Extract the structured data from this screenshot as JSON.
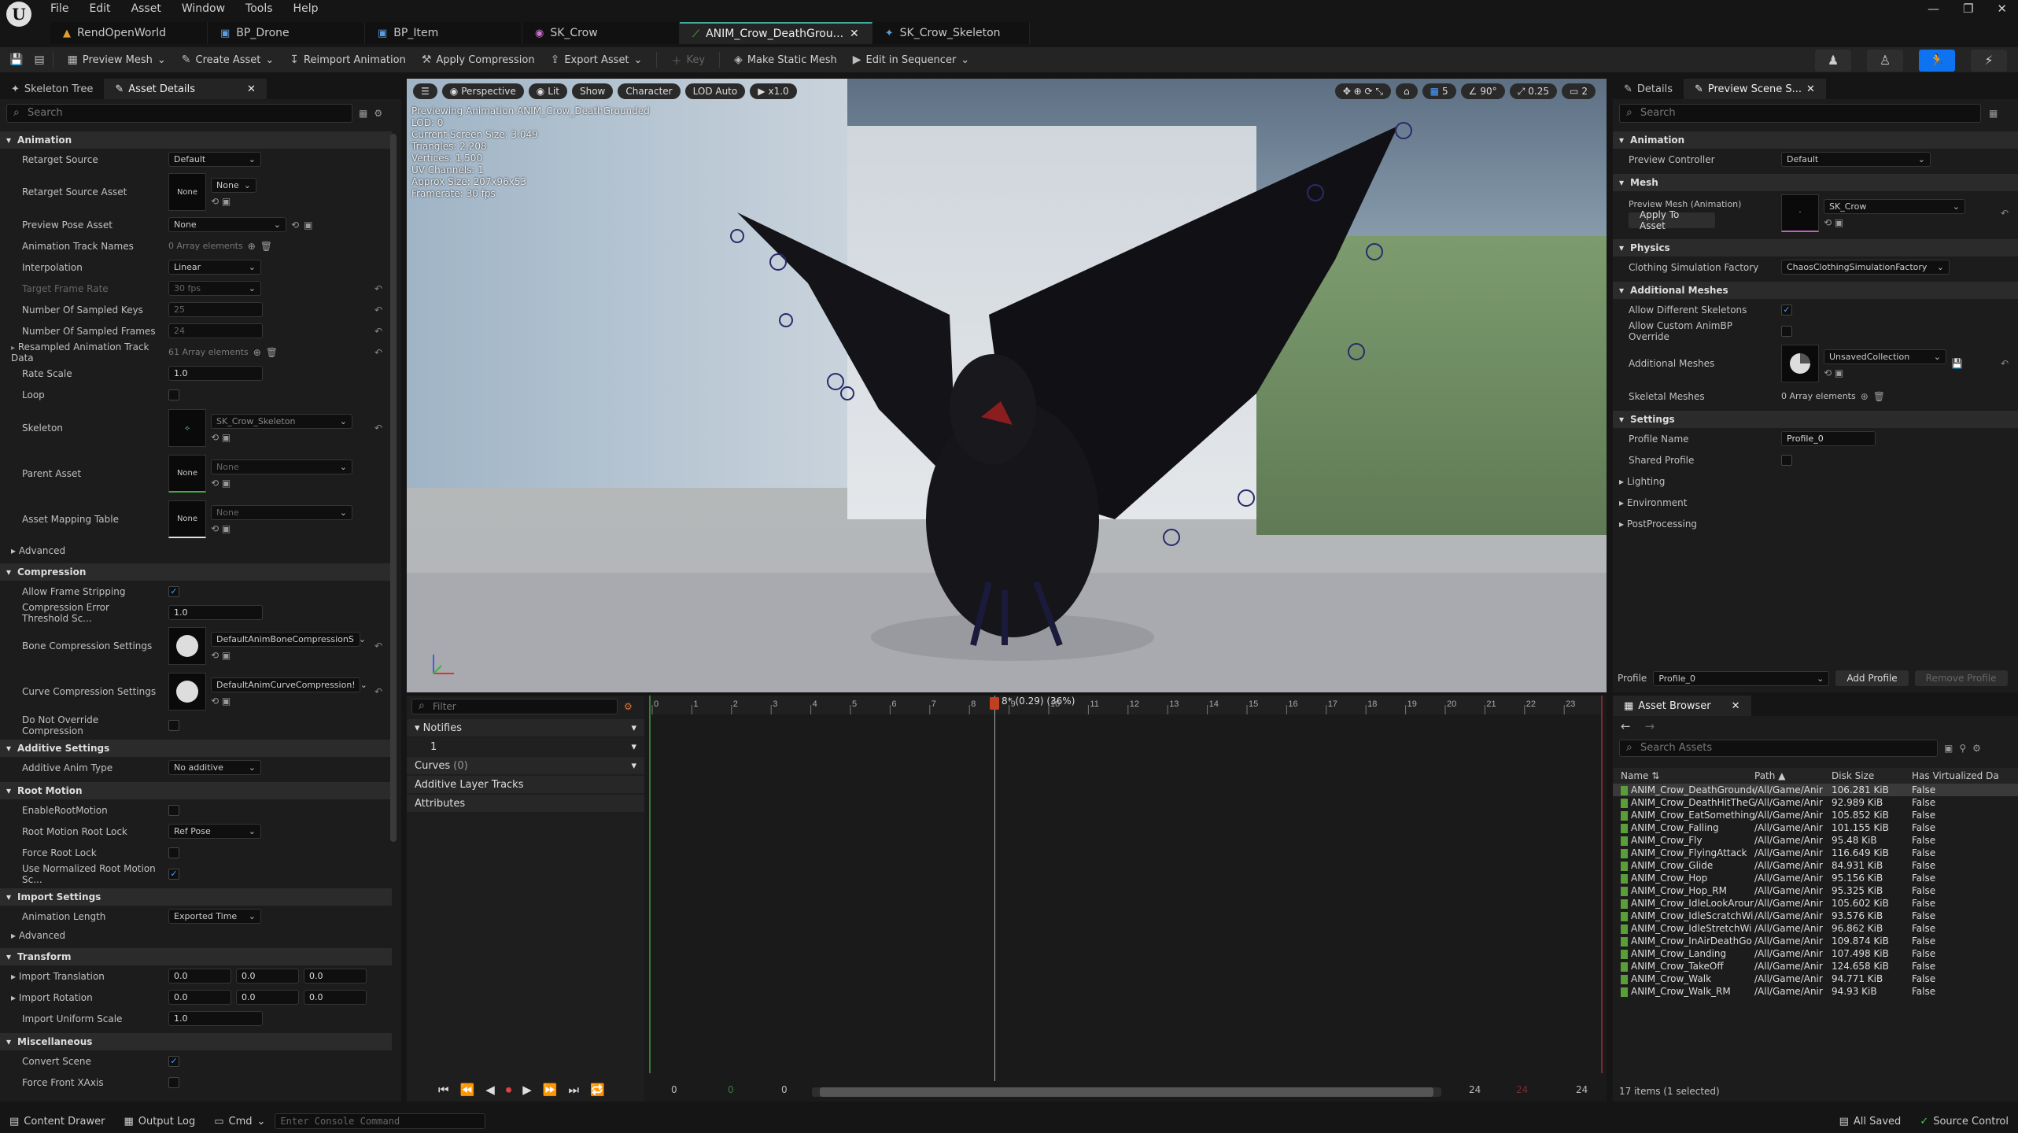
{
  "menu": [
    "File",
    "Edit",
    "Asset",
    "Window",
    "Tools",
    "Help"
  ],
  "doc_tabs": [
    {
      "label": "RendOpenWorld",
      "icon": "level-icon"
    },
    {
      "label": "BP_Drone",
      "icon": "blueprint-icon"
    },
    {
      "label": "BP_Item",
      "icon": "blueprint-icon"
    },
    {
      "label": "SK_Crow",
      "icon": "skeletal-mesh-icon"
    },
    {
      "label": "ANIM_Crow_DeathGrou...",
      "icon": "animation-icon",
      "active": true
    },
    {
      "label": "SK_Crow_Skeleton",
      "icon": "skeleton-icon"
    }
  ],
  "toolbar": {
    "preview_mesh": "Preview Mesh",
    "create_asset": "Create Asset",
    "reimport": "Reimport Animation",
    "apply_compression": "Apply Compression",
    "export_asset": "Export Asset",
    "key": "Key",
    "make_static_mesh": "Make Static Mesh",
    "edit_in_sequencer": "Edit in Sequencer"
  },
  "left_panel": {
    "tab_skeleton": "Skeleton Tree",
    "tab_details": "Asset Details",
    "search_placeholder": "Search",
    "cat_animation": "Animation",
    "cat_compression": "Compression",
    "cat_additive": "Additive Settings",
    "cat_root": "Root Motion",
    "cat_import": "Import Settings",
    "cat_transform": "Transform",
    "cat_misc": "Miscellaneous",
    "retarget_source": "Retarget Source",
    "retarget_source_val": "Default",
    "retarget_source_asset": "Retarget Source Asset",
    "none": "None",
    "preview_pose_asset": "Preview Pose Asset",
    "anim_track_names": "Animation Track Names",
    "array0": "0 Array elements",
    "interpolation": "Interpolation",
    "interpolation_val": "Linear",
    "target_frame_rate": "Target Frame Rate",
    "target_frame_rate_val": "30 fps",
    "num_sampled_keys": "Number Of Sampled Keys",
    "num_sampled_keys_val": "25",
    "num_sampled_frames": "Number Of Sampled Frames",
    "num_sampled_frames_val": "24",
    "resampled_track": "Resampled Animation Track Data",
    "array61": "61 Array elements",
    "rate_scale": "Rate Scale",
    "rate_scale_val": "1.0",
    "loop": "Loop",
    "skeleton": "Skeleton",
    "skeleton_val": "SK_Crow_Skeleton",
    "parent_asset": "Parent Asset",
    "asset_mapping": "Asset Mapping Table",
    "advanced": "Advanced",
    "allow_frame_stripping": "Allow Frame Stripping",
    "compression_error": "Compression Error Threshold Sc...",
    "compression_error_val": "1.0",
    "bone_compression": "Bone Compression Settings",
    "bone_compression_val": "DefaultAnimBoneCompressionS",
    "curve_compression": "Curve Compression Settings",
    "curve_compression_val": "DefaultAnimCurveCompression!",
    "do_not_override": "Do Not Override Compression",
    "additive_anim_type": "Additive Anim Type",
    "additive_anim_type_val": "No additive",
    "enable_root_motion": "EnableRootMotion",
    "root_motion_lock": "Root Motion Root Lock",
    "root_motion_lock_val": "Ref Pose",
    "force_root_lock": "Force Root Lock",
    "use_normalized": "Use Normalized Root Motion Sc...",
    "animation_length": "Animation Length",
    "animation_length_val": "Exported Time",
    "import_translation": "Import Translation",
    "import_rotation": "Import Rotation",
    "import_uniform_scale": "Import Uniform Scale",
    "zero": "0.0",
    "one": "1.0",
    "convert_scene": "Convert Scene",
    "force_front_xaxis": "Force Front XAxis"
  },
  "viewport": {
    "perspective": "Perspective",
    "lit": "Lit",
    "show": "Show",
    "character": "Character",
    "lod": "LOD Auto",
    "speed": "x1.0",
    "info": [
      "Previewing Animation ANIM_Crow_DeathGrounded",
      "LOD: 0",
      "Current Screen Size: 3.049",
      "Triangles: 2,208",
      "Vertices: 1,500",
      "UV Channels: 1",
      "Approx Size: 207x96x53",
      "Framerate: 30 fps"
    ],
    "grid": "5",
    "angle": "90°",
    "scale": "0.25",
    "cams": "2"
  },
  "timeline": {
    "filter_placeholder": "Filter",
    "notifies": "Notifies",
    "notify_track": "1",
    "curves": "Curves",
    "curves_count": "(0)",
    "additive_layer": "Additive Layer Tracks",
    "attributes": "Attributes",
    "playhead_label": "8* (0.29) (36%)",
    "ticks": [
      "0",
      "1",
      "2",
      "3",
      "4",
      "5",
      "6",
      "7",
      "8",
      "9",
      "10",
      "11",
      "12",
      "13",
      "14",
      "15",
      "16",
      "17",
      "18",
      "19",
      "20",
      "21",
      "22",
      "23"
    ],
    "range_start": "0",
    "range_start2": "0",
    "range_start3": "0",
    "range_end": "24",
    "range_end2": "24",
    "range_end3": "24"
  },
  "details": {
    "tab_details": "Details",
    "tab_preview": "Preview Scene S...",
    "search_placeholder": "Search",
    "cat_animation": "Animation",
    "preview_controller": "Preview Controller",
    "preview_controller_val": "Default",
    "cat_mesh": "Mesh",
    "preview_mesh": "Preview Mesh (Animation)",
    "preview_mesh_val": "SK_Crow",
    "apply_to_asset": "Apply To Asset",
    "cat_physics": "Physics",
    "clothing": "Clothing Simulation Factory",
    "clothing_val": "ChaosClothingSimulationFactory",
    "cat_additional": "Additional Meshes",
    "allow_diff": "Allow Different Skeletons",
    "allow_custom": "Allow Custom AnimBP Override",
    "additional_meshes": "Additional Meshes",
    "additional_meshes_val": "UnsavedCollection",
    "skeletal_meshes": "Skeletal Meshes",
    "array0": "0 Array elements",
    "cat_settings": "Settings",
    "profile_name": "Profile Name",
    "profile_name_val": "Profile_0",
    "shared_profile": "Shared Profile",
    "lighting": "Lighting",
    "environment": "Environment",
    "postprocessing": "PostProcessing",
    "profile_label": "Profile",
    "profile_val": "Profile_0",
    "add_profile": "Add Profile",
    "remove_profile": "Remove Profile"
  },
  "asset_browser": {
    "tab": "Asset Browser",
    "search_placeholder": "Search Assets",
    "col_name": "Name",
    "col_path": "Path",
    "col_size": "Disk Size",
    "col_virtual": "Has Virtualized Da",
    "rows": [
      {
        "name": "ANIM_Crow_DeathGrounde",
        "path": "/All/Game/Anir",
        "size": "106.281 KiB",
        "v": "False"
      },
      {
        "name": "ANIM_Crow_DeathHitTheG",
        "path": "/All/Game/Anir",
        "size": "92.989 KiB",
        "v": "False"
      },
      {
        "name": "ANIM_Crow_EatSomething",
        "path": "/All/Game/Anir",
        "size": "105.852 KiB",
        "v": "False"
      },
      {
        "name": "ANIM_Crow_Falling",
        "path": "/All/Game/Anir",
        "size": "101.155 KiB",
        "v": "False"
      },
      {
        "name": "ANIM_Crow_Fly",
        "path": "/All/Game/Anir",
        "size": "95.48 KiB",
        "v": "False"
      },
      {
        "name": "ANIM_Crow_FlyingAttack",
        "path": "/All/Game/Anir",
        "size": "116.649 KiB",
        "v": "False"
      },
      {
        "name": "ANIM_Crow_Glide",
        "path": "/All/Game/Anir",
        "size": "84.931 KiB",
        "v": "False"
      },
      {
        "name": "ANIM_Crow_Hop",
        "path": "/All/Game/Anir",
        "size": "95.156 KiB",
        "v": "False"
      },
      {
        "name": "ANIM_Crow_Hop_RM",
        "path": "/All/Game/Anir",
        "size": "95.325 KiB",
        "v": "False"
      },
      {
        "name": "ANIM_Crow_IdleLookArour",
        "path": "/All/Game/Anir",
        "size": "105.602 KiB",
        "v": "False"
      },
      {
        "name": "ANIM_Crow_IdleScratchWi",
        "path": "/All/Game/Anir",
        "size": "93.576 KiB",
        "v": "False"
      },
      {
        "name": "ANIM_Crow_IdleStretchWi",
        "path": "/All/Game/Anir",
        "size": "96.862 KiB",
        "v": "False"
      },
      {
        "name": "ANIM_Crow_InAirDeathGo",
        "path": "/All/Game/Anir",
        "size": "109.874 KiB",
        "v": "False"
      },
      {
        "name": "ANIM_Crow_Landing",
        "path": "/All/Game/Anir",
        "size": "107.498 KiB",
        "v": "False"
      },
      {
        "name": "ANIM_Crow_TakeOff",
        "path": "/All/Game/Anir",
        "size": "124.658 KiB",
        "v": "False"
      },
      {
        "name": "ANIM_Crow_Walk",
        "path": "/All/Game/Anir",
        "size": "94.771 KiB",
        "v": "False"
      },
      {
        "name": "ANIM_Crow_Walk_RM",
        "path": "/All/Game/Anir",
        "size": "94.93 KiB",
        "v": "False"
      }
    ],
    "count": "17 items (1 selected)"
  },
  "statusbar": {
    "content_drawer": "Content Drawer",
    "output_log": "Output Log",
    "cmd": "Cmd",
    "console_placeholder": "Enter Console Command",
    "all_saved": "All Saved",
    "source_control": "Source Control"
  }
}
